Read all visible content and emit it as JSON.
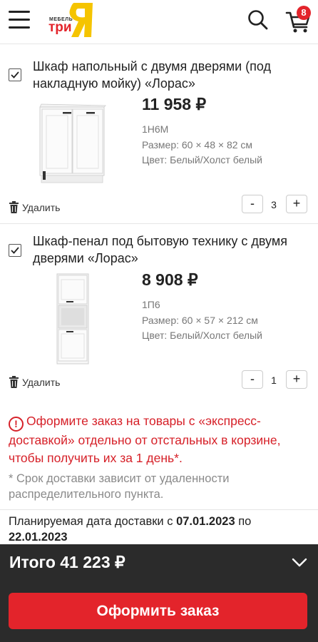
{
  "header": {
    "logo_small": "МЕБЕЛЬ",
    "logo_main": "три",
    "logo_letter": "Я",
    "cart_count": "8"
  },
  "items": [
    {
      "title": "Шкаф напольный с двумя дверями (под накладную мойку) «Лорас»",
      "price": "11 958 ₽",
      "sku": "1Н6М",
      "size": "Размер: 60 × 48 × 82 см",
      "color": "Цвет: Белый/Холст белый",
      "delete_label": "Удалить",
      "quantity": "3",
      "checked": true
    },
    {
      "title": "Шкаф-пенал под бытовую технику с двумя дверями «Лорас»",
      "price": "8 908 ₽",
      "sku": "1П6",
      "size": "Размер: 60 × 57 × 212 см",
      "color": "Цвет: Белый/Холст белый",
      "delete_label": "Удалить",
      "quantity": "1",
      "checked": true
    }
  ],
  "qty_minus": "-",
  "qty_plus": "+",
  "warning": {
    "icon": "!",
    "text": "Оформите заказ на товары с «экспресс-доставкой» отдельно от отстальных в корзине, чтобы получить их за 1 день*."
  },
  "note": "* Срок доставки зависит от удаленности распределительного пункта.",
  "delivery": {
    "prefix": "Планируемая дата доставки с ",
    "date_from": "07.01.2023",
    "middle": " по ",
    "date_to": "22.01.2023"
  },
  "summary": {
    "total": "Итого 41 223 ₽",
    "order_button": "Оформить заказ"
  },
  "colors": {
    "accent": "#e3242b",
    "logo_yellow": "#f5c400",
    "bottom_bar": "#2b2b2b"
  }
}
